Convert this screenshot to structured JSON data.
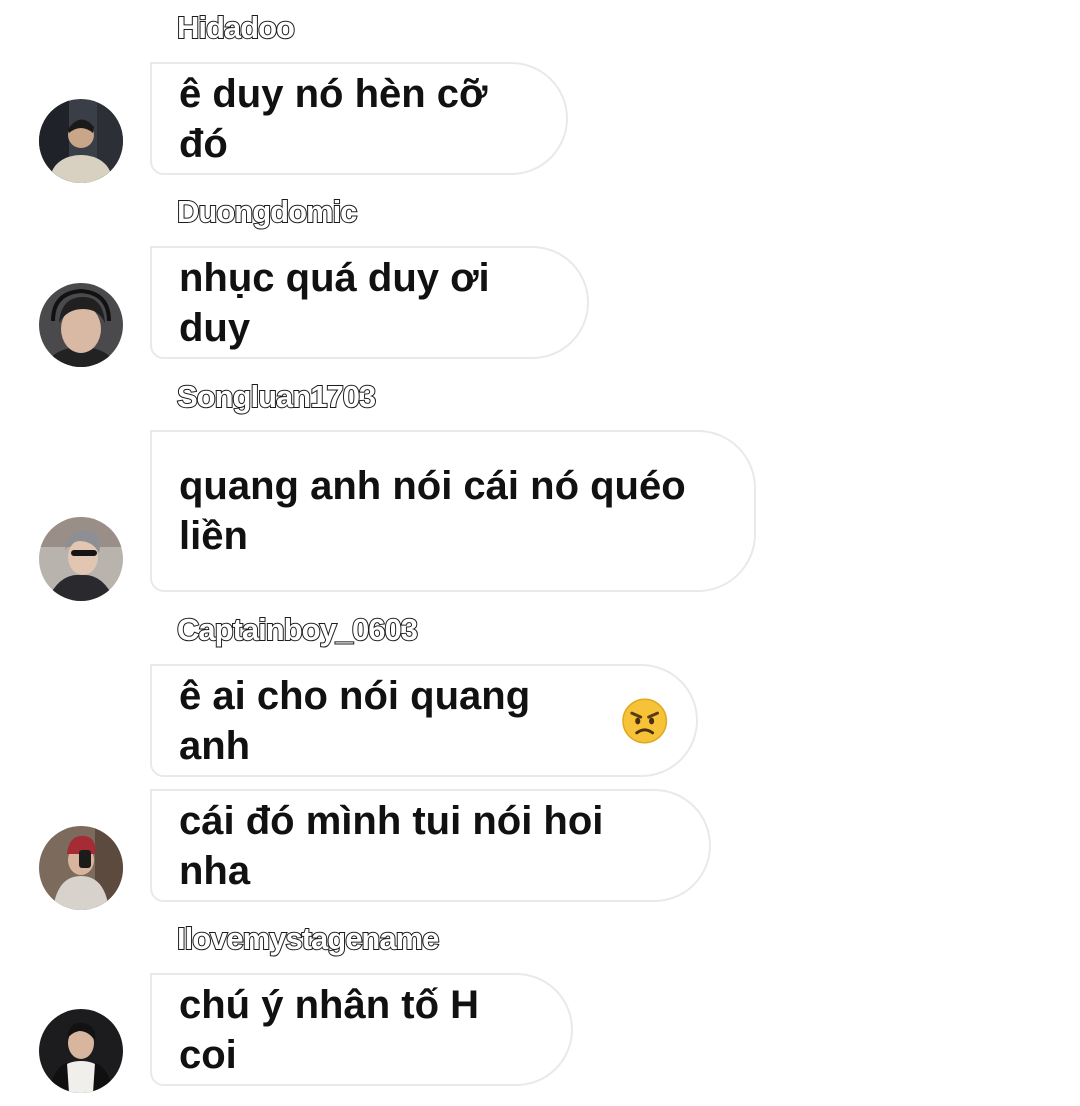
{
  "messages": [
    {
      "user": "Hidadoo",
      "text": "ê duy nó hèn cỡ đó"
    },
    {
      "user": "Duongdomic",
      "text": "nhục quá duy ơi duy"
    },
    {
      "user": "Songluan1703",
      "text_line1": "quang anh nói cái nó quéo",
      "text_line2": "liền"
    },
    {
      "user": "Captainboy_0603",
      "text": "ê ai cho nói quang anh",
      "emoji": "angry-face-emoji",
      "text2": "cái đó mình tui nói hoi nha"
    },
    {
      "user": "Ilovemystagename",
      "text": "chú ý nhân tố H coi"
    }
  ]
}
